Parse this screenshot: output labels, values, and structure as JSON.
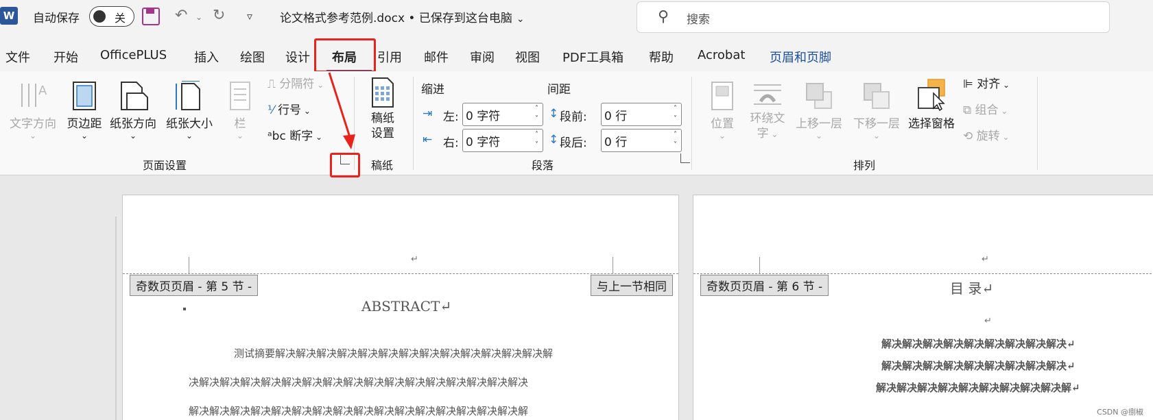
{
  "titlebar": {
    "logo": "W",
    "autosave_label": "自动保存",
    "autosave_state": "关",
    "doc_title": "论文格式参考范例.docx • 已保存到这台电脑",
    "search_placeholder": "搜索"
  },
  "tabs": [
    "文件",
    "开始",
    "OfficePLUS",
    "插入",
    "绘图",
    "设计",
    "布局",
    "引用",
    "邮件",
    "审阅",
    "视图",
    "PDF工具箱",
    "帮助",
    "Acrobat",
    "页眉和页脚"
  ],
  "active_tab": "布局",
  "ribbon": {
    "page_setup": {
      "text_direction": "文字方向",
      "margins": "页边距",
      "orientation": "纸张方向",
      "size": "纸张大小",
      "columns": "栏",
      "breaks": "分隔符",
      "line_numbers": "行号",
      "hyphenation": "断字",
      "label": "页面设置"
    },
    "manuscript": {
      "settings": "稿纸\n设置",
      "label": "稿纸"
    },
    "paragraph": {
      "indent_title": "缩进",
      "spacing_title": "间距",
      "left_label": "左:",
      "right_label": "右:",
      "before_label": "段前:",
      "after_label": "段后:",
      "left_value": "0 字符",
      "right_value": "0 字符",
      "before_value": "0 行",
      "after_value": "0 行",
      "label": "段落"
    },
    "arrange": {
      "position": "位置",
      "wrap_line1": "环绕文",
      "wrap_line2": "字",
      "bring_forward": "上移一层",
      "send_backward": "下移一层",
      "selection_pane": "选择窗格",
      "align": "对齐",
      "group": "组合",
      "rotate": "旋转",
      "label": "排列"
    }
  },
  "document": {
    "page1": {
      "header_tag": "奇数页页眉 - 第 5 节 -",
      "same_as_previous": "与上一节相同",
      "heading": "ABSTRACT↵",
      "lines": [
        "测试摘要解决解决解决解决解决解决解决解决解决解决解决解决解决解",
        "决解决解决解决解决解决解决解决解决解决解决解决解决解决解决解决解决",
        "解决解决解决解决解决解决解决解决解决解决解决解决解决解决解决解决解"
      ]
    },
    "page2": {
      "header_tag": "奇数页页眉 - 第 6 节 -",
      "heading": "目   录↵",
      "lines": [
        "解决解决解决解决解决解决解决解决解决↵",
        "解决解决解决解决解决解决解决解决解决↵",
        "解决解决解决解决解决解决解决解决解决解↵"
      ]
    },
    "para_mark": "↵"
  },
  "watermark": "CSDN @捌椒",
  "colors": {
    "highlight": "#e8231c",
    "word_blue": "#2b579a",
    "context_tab": "#1a4fa0"
  }
}
